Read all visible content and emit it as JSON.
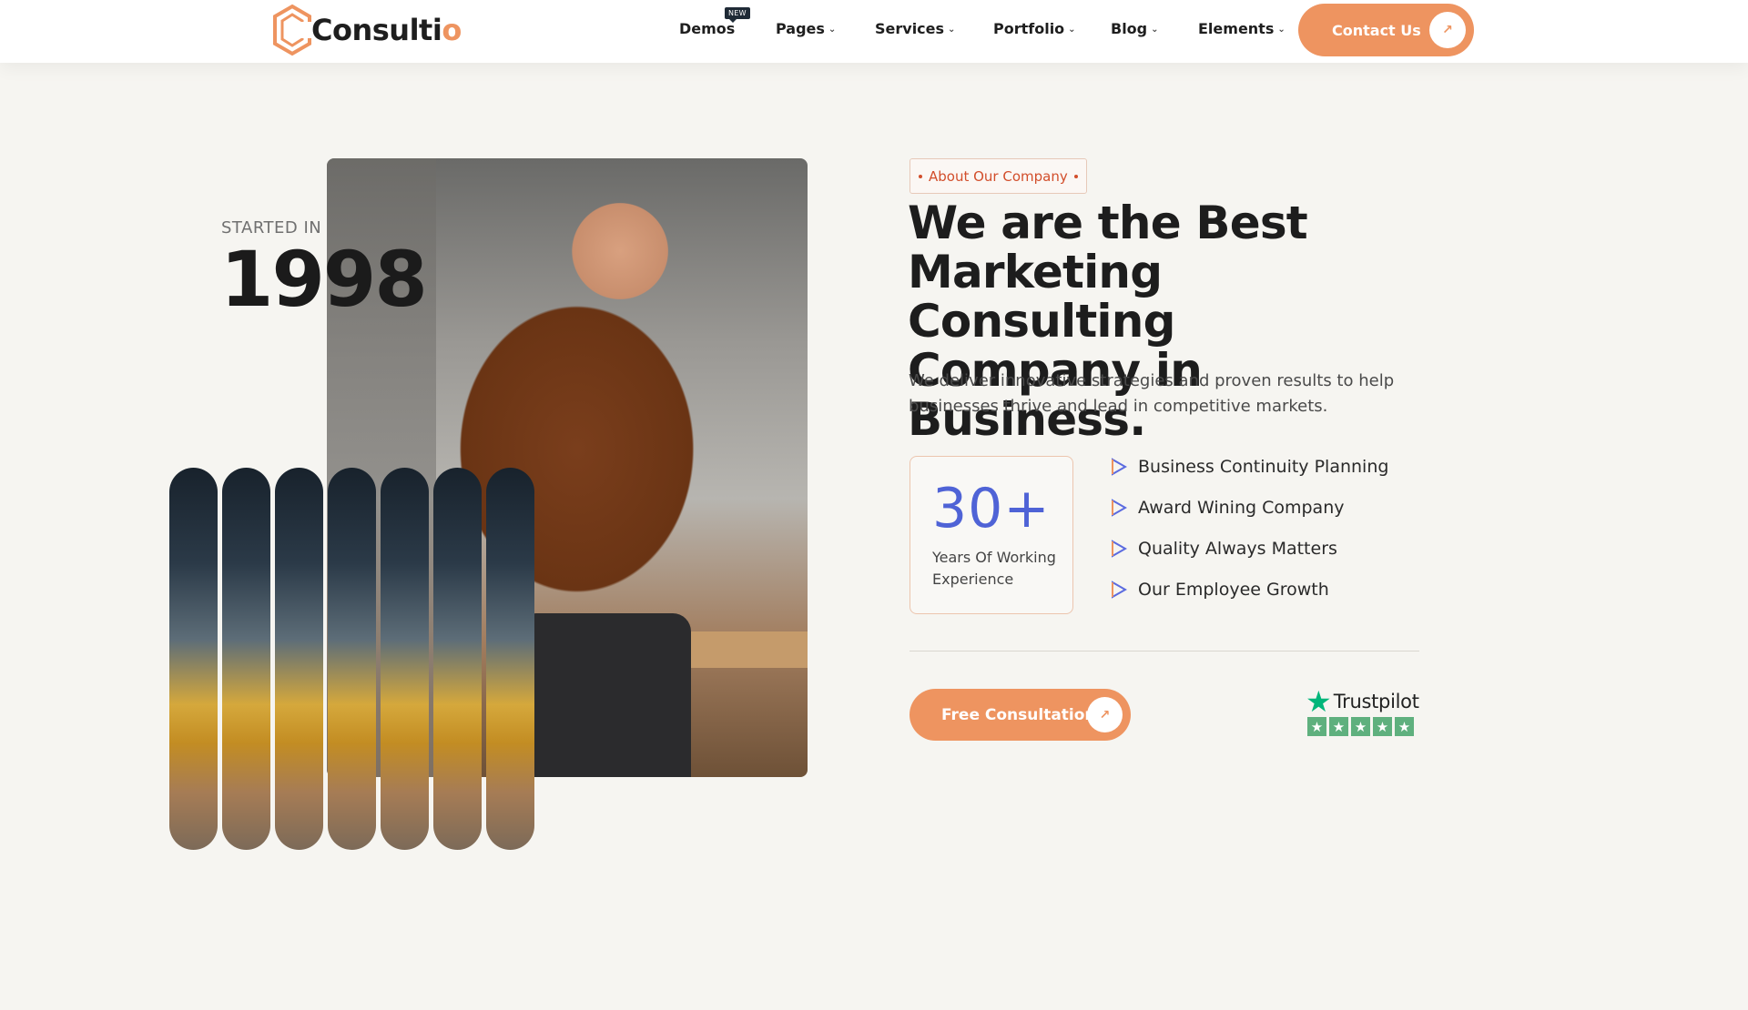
{
  "header": {
    "logo": {
      "text": "Consulti",
      "accent": "o"
    },
    "nav": [
      {
        "label": "Demos",
        "badge": "NEW",
        "has_dropdown": false
      },
      {
        "label": "Pages",
        "has_dropdown": true
      },
      {
        "label": "Services",
        "has_dropdown": true
      },
      {
        "label": "Portfolio",
        "has_dropdown": true
      },
      {
        "label": "Blog",
        "has_dropdown": true
      },
      {
        "label": "Elements",
        "has_dropdown": true
      }
    ],
    "cta": {
      "label": "Contact Us",
      "icon": "arrow-up-right-icon"
    }
  },
  "hero": {
    "started_label": "STARTED IN",
    "started_year": "1998",
    "tag": "About Our Company",
    "headline": "We are the Best Marketing Consulting Company in Business.",
    "description": "We deliver innovative strategies and proven results to help businesses thrive and lead in competitive markets.",
    "stat": {
      "value": "30+",
      "label": "Years Of Working Experience"
    },
    "features": [
      "Business Continuity Planning",
      "Award Wining Company",
      "Quality Always Matters",
      "Our Employee Growth"
    ],
    "cta": {
      "label": "Free Consultation",
      "icon": "arrow-up-right-icon"
    },
    "trustpilot": {
      "name": "Trustpilot",
      "stars": 5
    }
  },
  "colors": {
    "accent": "#ee9460",
    "stat": "#4f63d6",
    "tag": "#d24e2b",
    "trustpilot": "#00b67a"
  }
}
